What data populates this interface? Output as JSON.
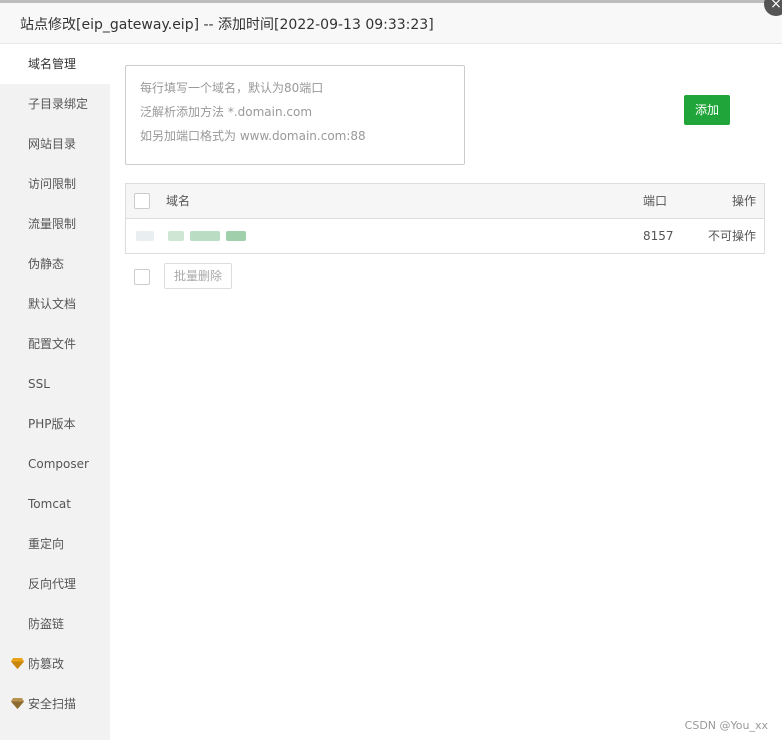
{
  "window": {
    "title": "站点修改[eip_gateway.eip] -- 添加时间[2022-09-13 09:33:23]",
    "close_label": "×"
  },
  "sidebar": {
    "items": [
      {
        "label": "域名管理"
      },
      {
        "label": "子目录绑定"
      },
      {
        "label": "网站目录"
      },
      {
        "label": "访问限制"
      },
      {
        "label": "流量限制"
      },
      {
        "label": "伪静态"
      },
      {
        "label": "默认文档"
      },
      {
        "label": "配置文件"
      },
      {
        "label": "SSL"
      },
      {
        "label": "PHP版本"
      },
      {
        "label": "Composer"
      },
      {
        "label": "Tomcat"
      },
      {
        "label": "重定向"
      },
      {
        "label": "反向代理"
      },
      {
        "label": "防盗链"
      },
      {
        "label": "防篡改",
        "icon": "gem-icon"
      },
      {
        "label": "安全扫描",
        "icon": "gem-icon"
      }
    ]
  },
  "domain_input": {
    "placeholder_lines": [
      "每行填写一个域名，默认为80端口",
      "泛解析添加方法 *.domain.com",
      "如另加端口格式为 www.domain.com:88"
    ]
  },
  "add_button": {
    "label": "添加"
  },
  "table": {
    "headers": {
      "domain": "域名",
      "port": "端口",
      "action": "操作"
    },
    "rows": [
      {
        "domain": "",
        "port": "8157",
        "action": "不可操作"
      }
    ]
  },
  "batch_delete": {
    "label": "批量删除"
  },
  "watermark": {
    "text": "CSDN @You_xx"
  },
  "colors": {
    "accent": "#20a53a",
    "gem": "#e8a317"
  }
}
